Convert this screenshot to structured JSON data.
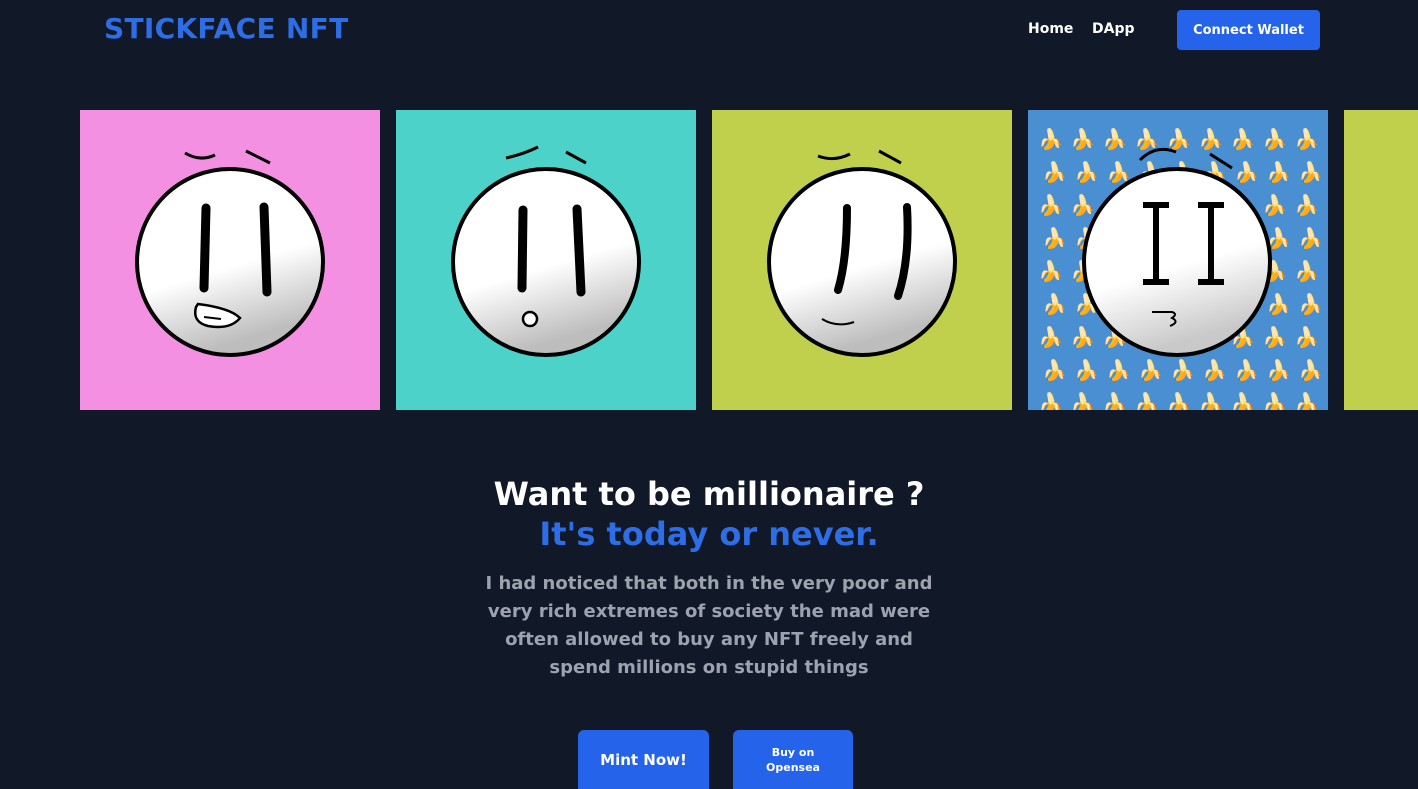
{
  "header": {
    "brand": "STICKFACE NFT",
    "nav": {
      "home": "Home",
      "dapp": "DApp"
    },
    "connect_wallet": "Connect Wallet"
  },
  "gallery": {
    "tiles": [
      {
        "background": "#f490e2",
        "face": "tongue"
      },
      {
        "background": "#4dd2c9",
        "face": "surprised"
      },
      {
        "background": "#c1d04c",
        "face": "smirk"
      },
      {
        "background": "#4a8fd1",
        "face": "banana-pattern"
      },
      {
        "background": "#c1d04c",
        "face": "partial"
      }
    ],
    "banana_glyph": "🍌"
  },
  "hero": {
    "headline": "Want to be millionaire ?",
    "tagline": "It's today or never.",
    "description": "I had noticed that both in the very poor and very rich extremes of society the mad were often allowed to buy any NFT freely and spend millions on stupid things",
    "mint_button": "Mint Now!",
    "opensea_button_line1": "Buy on",
    "opensea_button_line2": "Opensea"
  },
  "colors": {
    "background": "#111827",
    "accent": "#2563eb",
    "brand_text": "#2d6ee6",
    "muted_text": "#9ca3af"
  }
}
